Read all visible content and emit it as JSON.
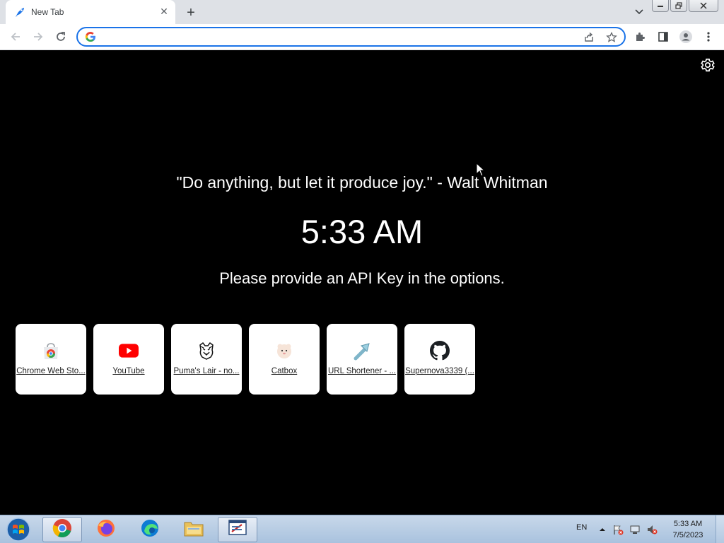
{
  "tab": {
    "title": "New Tab",
    "close_glyph": "✕"
  },
  "newtab": {
    "glyph": "+"
  },
  "omnibox": {
    "value": "",
    "placeholder": ""
  },
  "page": {
    "quote": "\"Do anything, but let it produce joy.\" - Walt Whitman",
    "time": "5:33 AM",
    "api_message": "Please provide an API Key in the options."
  },
  "shortcuts": [
    {
      "label": "Chrome Web Sto...",
      "icon": "chrome-web-store-icon"
    },
    {
      "label": "YouTube",
      "icon": "youtube-icon"
    },
    {
      "label": "Puma's Lair - no...",
      "icon": "puma-icon"
    },
    {
      "label": "Catbox",
      "icon": "catbox-icon"
    },
    {
      "label": "URL Shortener - ...",
      "icon": "url-shortener-icon"
    },
    {
      "label": "Supernova3339 (...",
      "icon": "github-icon"
    }
  ],
  "taskbar": {
    "language": "EN",
    "time": "5:33 AM",
    "date": "7/5/2023"
  },
  "colors": {
    "accent": "#1a73e8",
    "page_bg": "#000000",
    "youtube_red": "#ff0000"
  }
}
